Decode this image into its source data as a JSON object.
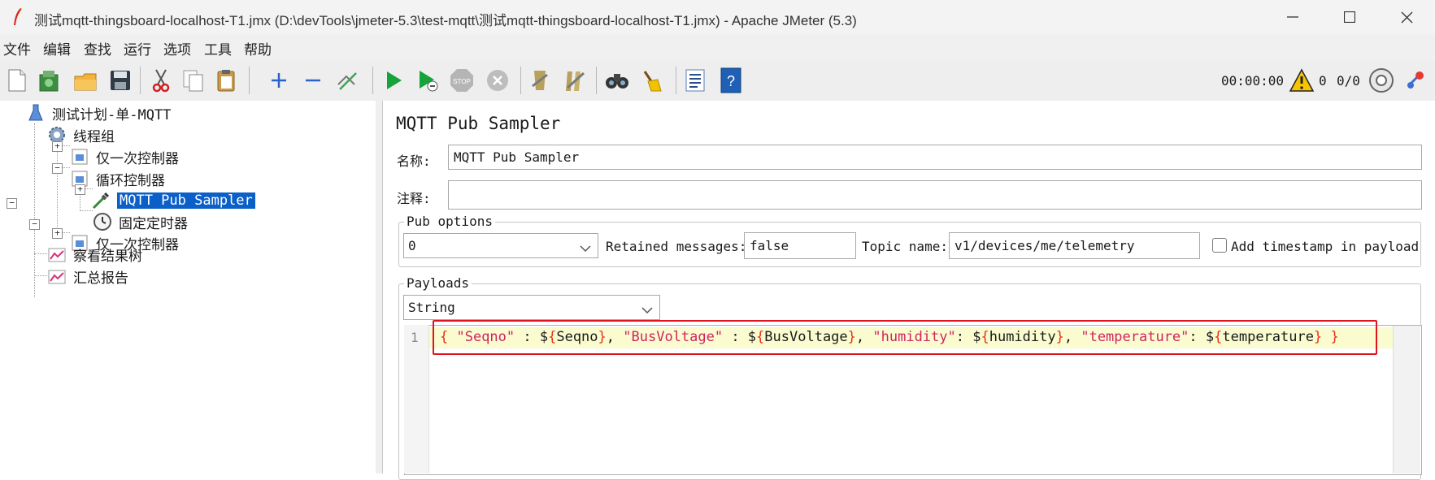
{
  "window": {
    "title": "测试mqtt-thingsboard-localhost-T1.jmx (D:\\devTools\\jmeter-5.3\\test-mqtt\\测试mqtt-thingsboard-localhost-T1.jmx) - Apache JMeter (5.3)"
  },
  "menu": [
    "文件",
    "编辑",
    "查找",
    "运行",
    "选项",
    "工具",
    "帮助"
  ],
  "toolbar": {
    "timer": "00:00:00",
    "warning_count": "0",
    "thread_count": "0/0"
  },
  "tree": [
    {
      "label": "测试计划-单-MQTT",
      "icon": "test-plan-icon"
    },
    {
      "label": "线程组",
      "icon": "thread-group-gear-icon"
    },
    {
      "label": "仅一次控制器",
      "icon": "controller-icon"
    },
    {
      "label": "循环控制器",
      "icon": "controller-icon"
    },
    {
      "label": "MQTT Pub Sampler",
      "icon": "sampler-pipette-icon",
      "selected": true
    },
    {
      "label": "固定定时器",
      "icon": "timer-clock-icon"
    },
    {
      "label": "仅一次控制器",
      "icon": "controller-icon"
    },
    {
      "label": "察看结果树",
      "icon": "listener-graph-icon"
    },
    {
      "label": "汇总报告",
      "icon": "listener-graph-icon"
    }
  ],
  "sampler": {
    "title": "MQTT Pub Sampler",
    "name_label": "名称:",
    "name_value": "MQTT Pub Sampler",
    "comment_label": "注释:",
    "comment_value": ""
  },
  "pub_options": {
    "group_title": "Pub options",
    "qos_value": "0",
    "retained_label": "Retained messages:",
    "retained_value": "false",
    "topic_label": "Topic name:",
    "topic_value": "v1/devices/me/telemetry",
    "timestamp_label": "Add timestamp in payload",
    "timestamp_checked": false
  },
  "payloads": {
    "group_title": "Payloads",
    "type_value": "String",
    "line_number": "1",
    "tokens": [
      {
        "t": "{ ",
        "c": "brace"
      },
      {
        "t": "\"Seqno\"",
        "c": "str"
      },
      {
        "t": " : $",
        "c": "plain"
      },
      {
        "t": "{",
        "c": "brace"
      },
      {
        "t": "Seqno",
        "c": "plain"
      },
      {
        "t": "}",
        "c": "brace"
      },
      {
        "t": ", ",
        "c": "plain"
      },
      {
        "t": "\"BusVoltage\"",
        "c": "str"
      },
      {
        "t": " : $",
        "c": "plain"
      },
      {
        "t": "{",
        "c": "brace"
      },
      {
        "t": "BusVoltage",
        "c": "plain"
      },
      {
        "t": "}",
        "c": "brace"
      },
      {
        "t": ", ",
        "c": "plain"
      },
      {
        "t": "\"humidity\"",
        "c": "str"
      },
      {
        "t": ": $",
        "c": "plain"
      },
      {
        "t": "{",
        "c": "brace"
      },
      {
        "t": "humidity",
        "c": "plain"
      },
      {
        "t": "}",
        "c": "brace"
      },
      {
        "t": ", ",
        "c": "plain"
      },
      {
        "t": "\"temperature\"",
        "c": "str"
      },
      {
        "t": ": $",
        "c": "plain"
      },
      {
        "t": "{",
        "c": "brace"
      },
      {
        "t": "temperature",
        "c": "plain"
      },
      {
        "t": "}",
        "c": "brace"
      },
      {
        "t": " }",
        "c": "brace"
      }
    ]
  },
  "colors": {
    "selection": "#0a5fc8",
    "annotation_box": "#e0141e",
    "string": "#d02462",
    "line_highlight": "#fbfbd0"
  }
}
